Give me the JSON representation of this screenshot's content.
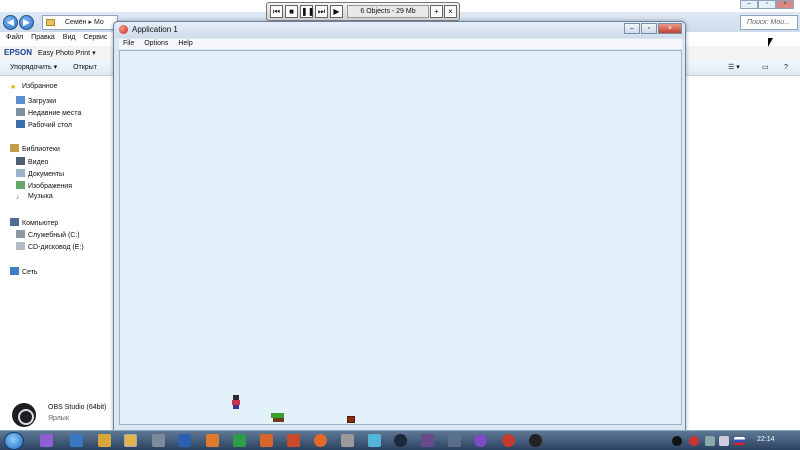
{
  "explorer": {
    "breadcrumb": [
      "Семён",
      "Мо"
    ],
    "search_placeholder": "Поиск: Мои...",
    "menu": [
      "Файл",
      "Правка",
      "Вид",
      "Сервис"
    ],
    "epson_brand": "EPSON",
    "epson_app": "Easy Photo Print",
    "toolbar_organize": "Упорядочить",
    "toolbar_open": "Открыт",
    "sidebar": {
      "favorites_header": "Избранное",
      "favorites": [
        "Загрузки",
        "Недавние места",
        "Рабочий стол"
      ],
      "libraries_header": "Библиотеки",
      "libraries": [
        "Видео",
        "Документы",
        "Изображения",
        "Музыка"
      ],
      "computer_header": "Компьютер",
      "drives": [
        "Служебный (C:)",
        "CD-дисковод (E:)"
      ],
      "network": "Сеть"
    }
  },
  "obs": {
    "name": "OBS Studio (64bit)",
    "type": "Ярлык"
  },
  "app_window": {
    "title": "Application 1",
    "menu": [
      "File",
      "Options",
      "Help"
    ]
  },
  "media_bar": {
    "info": "6 Objects - 29 Mb"
  },
  "taskbar": {
    "time": "22:14"
  },
  "colors": {
    "game_bg": "#e3f1fa",
    "taskbar": "#2b4260",
    "accent": "#2d6fc2"
  }
}
